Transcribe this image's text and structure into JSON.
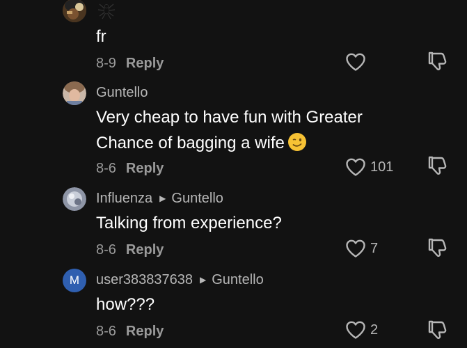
{
  "comments": [
    {
      "username": "",
      "text": "fr",
      "date": "8-9",
      "reply_label": "Reply",
      "like_count": ""
    },
    {
      "username": "Guntello",
      "text": "Very cheap to have fun with Greater",
      "text_line2": "Chance of bagging a wife",
      "emoji": "winking-face",
      "date": "8-6",
      "reply_label": "Reply",
      "like_count": "101"
    },
    {
      "username": "Influenza",
      "reply_to": "Guntello",
      "text": "Talking from experience?",
      "date": "8-6",
      "reply_label": "Reply",
      "like_count": "7"
    },
    {
      "username": "user383837638",
      "reply_to": "Guntello",
      "avatar_initial": "M",
      "text": "how???",
      "date": "8-6",
      "reply_label": "Reply",
      "like_count": "2"
    }
  ],
  "colors": {
    "background": "#121212",
    "username": "#b7b7b7",
    "meta": "#9b9b9b",
    "text": "#ffffff",
    "avatar_blue": "#2f5fb0",
    "emoji_yellow": "#f7c234"
  },
  "icons": {
    "like": "heart-outline-icon",
    "dislike": "thumbs-down-outline-icon",
    "reply_arrow": "triangle-right-icon"
  }
}
